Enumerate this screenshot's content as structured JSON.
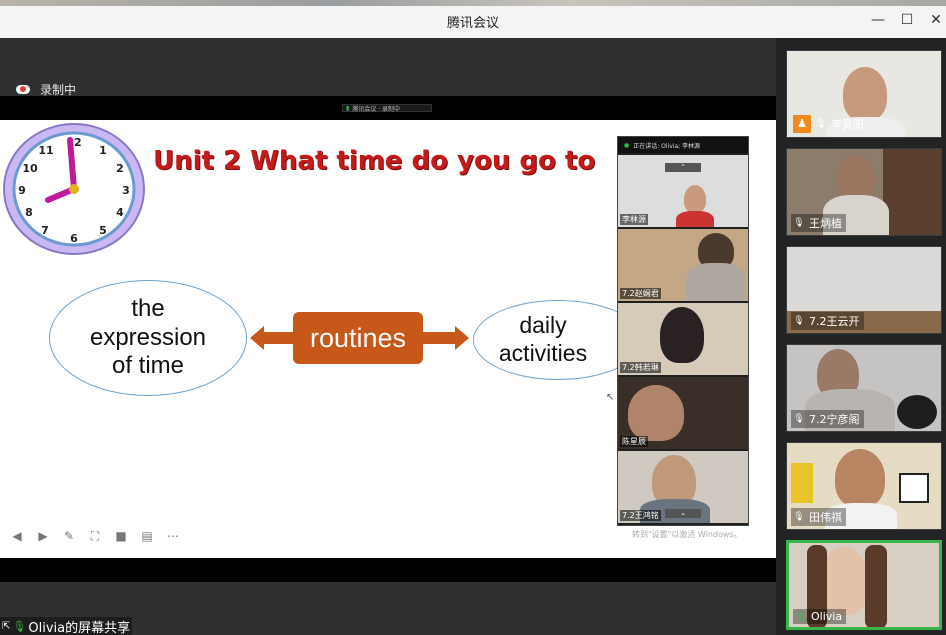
{
  "window": {
    "title": "腾讯会议",
    "minimize": "—",
    "maximize": "☐",
    "close": "✕"
  },
  "recording": {
    "label": "录制中"
  },
  "minibar": {
    "text": "腾讯会议 · 录制中"
  },
  "slide": {
    "title": "Unit 2 What time do you go to",
    "left_oval": {
      "line1": "the",
      "line2": "expression",
      "line3": "of time"
    },
    "center": "routines",
    "right_oval": {
      "line1": "daily",
      "line2": "activities"
    },
    "controls": [
      "prev-icon",
      "next-icon",
      "pen-icon",
      "fit-icon",
      "camera-icon",
      "comment-icon",
      "more-icon"
    ]
  },
  "inner_panel": {
    "header": "正在讲话: Olivia; 李林源",
    "tiles": [
      "李林源",
      "7.2赵娴君",
      "7.2韩若琳",
      "陈星辰",
      "7.2王鸿铭"
    ],
    "watermark": "转到\"设置\"以激活 Windows。"
  },
  "participants": [
    {
      "name": "李昊阳",
      "host": true
    },
    {
      "name": "王炳植",
      "host": false
    },
    {
      "name": "7.2王云开",
      "host": false
    },
    {
      "name": "7.2宁彦阁",
      "host": false
    },
    {
      "name": "田伟祺",
      "host": false
    },
    {
      "name": "Olivia",
      "host": false,
      "speaking": true
    }
  ],
  "share": {
    "label": "Olivia的屏幕共享"
  },
  "colors": {
    "accent": "#c8571a",
    "title_red": "#c41a1a",
    "speaking": "#3ab54a"
  }
}
